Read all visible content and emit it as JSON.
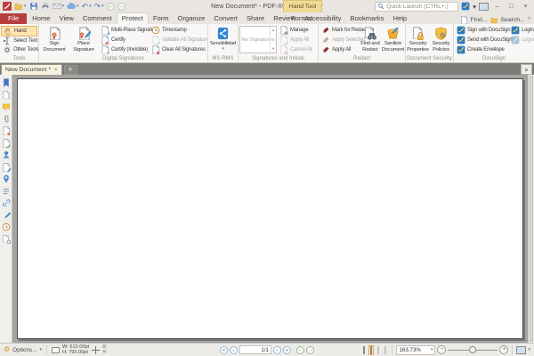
{
  "icons": {
    "chevron_down": "▾",
    "scroll_up": "▴",
    "scroll_down": "▾",
    "collapse_ribbon": "^",
    "minimize": "–",
    "maximize": "□",
    "close": "×",
    "tab_close": "×",
    "add_tab": "+",
    "undo": "↶",
    "redo": "↷",
    "back": "←",
    "forward": "→",
    "first_page": "«",
    "prev_page": "‹",
    "next_page": "›",
    "last_page": "»",
    "zoom_out": "−",
    "zoom_in": "+",
    "gear": "⚙",
    "quick_launch_magnifier": "search-icon",
    "page_slash": "/"
  },
  "titlebar": {
    "title": "New Document* - PDF-XChange Editor",
    "quick_launch": "Quick Launch (CTRL+.)",
    "contextual_header": "Hand Tool"
  },
  "tabs": {
    "file": "File",
    "home": "Home",
    "view": "View",
    "comment": "Comment",
    "protect": "Protect",
    "form": "Form",
    "organize": "Organize",
    "convert": "Convert",
    "share": "Share",
    "review": "Review",
    "accessibility": "Accessibility",
    "bookmarks": "Bookmarks",
    "help": "Help",
    "format": "Format",
    "find": "Find...",
    "search": "Search..."
  },
  "ribbon": {
    "tools": {
      "label": "Tools",
      "hand": "Hand",
      "select_text": "Select Text",
      "other_tools": "Other Tools"
    },
    "digital_signatures": {
      "label": "Digital Signatures",
      "sign_document": "Sign Document",
      "place_signature": "Place Signature",
      "multi_place": "Multi-Place Signature",
      "certify": "Certify",
      "certify_invisible": "Certify (Invisible)",
      "timestamp": "Timestamp",
      "validate_all": "Validate All Signatures",
      "clear_all": "Clear All Signatures"
    },
    "ms_rms": {
      "label": "MS RMS",
      "sensitivity": "Sensibilidad"
    },
    "signatures": {
      "label": "Signatures and Initials",
      "empty": "No Signatures",
      "manage": "Manage",
      "apply_all": "Apply All",
      "cancel_all": "Cancel All"
    },
    "redact": {
      "label": "Redact",
      "mark": "Mark for Redaction",
      "apply_selected": "Apply Selected",
      "apply_all": "Apply All",
      "find_and_redact": "Find and Redact",
      "sanitize": "Sanitize Document"
    },
    "document_security": {
      "label": "Document Security",
      "properties": "Security Properties",
      "policies": "Security Policies"
    },
    "docusign": {
      "label": "DocuSign",
      "sign": "Sign with DocuSign",
      "send": "Send with DocuSign",
      "envelope": "Create Envelope",
      "login": "Login",
      "logout": "Logout"
    }
  },
  "document_tabs": {
    "active": "New Document *"
  },
  "statusbar": {
    "options": "Options...",
    "width": "W: 612.00pt",
    "height": "H: 792.00pt",
    "x": "X:",
    "y": "Y:",
    "page": "1/1",
    "zoom": "163.73%"
  },
  "colors": {
    "file_tab_red": "#b63e3e",
    "contextual_yellow": "#f0da96",
    "selected_tool_orange": "#fde4b0",
    "docusign_blue": "#2b7bc4",
    "nav_blue": "#4a82c0",
    "nav_green": "#5a9e4e"
  }
}
